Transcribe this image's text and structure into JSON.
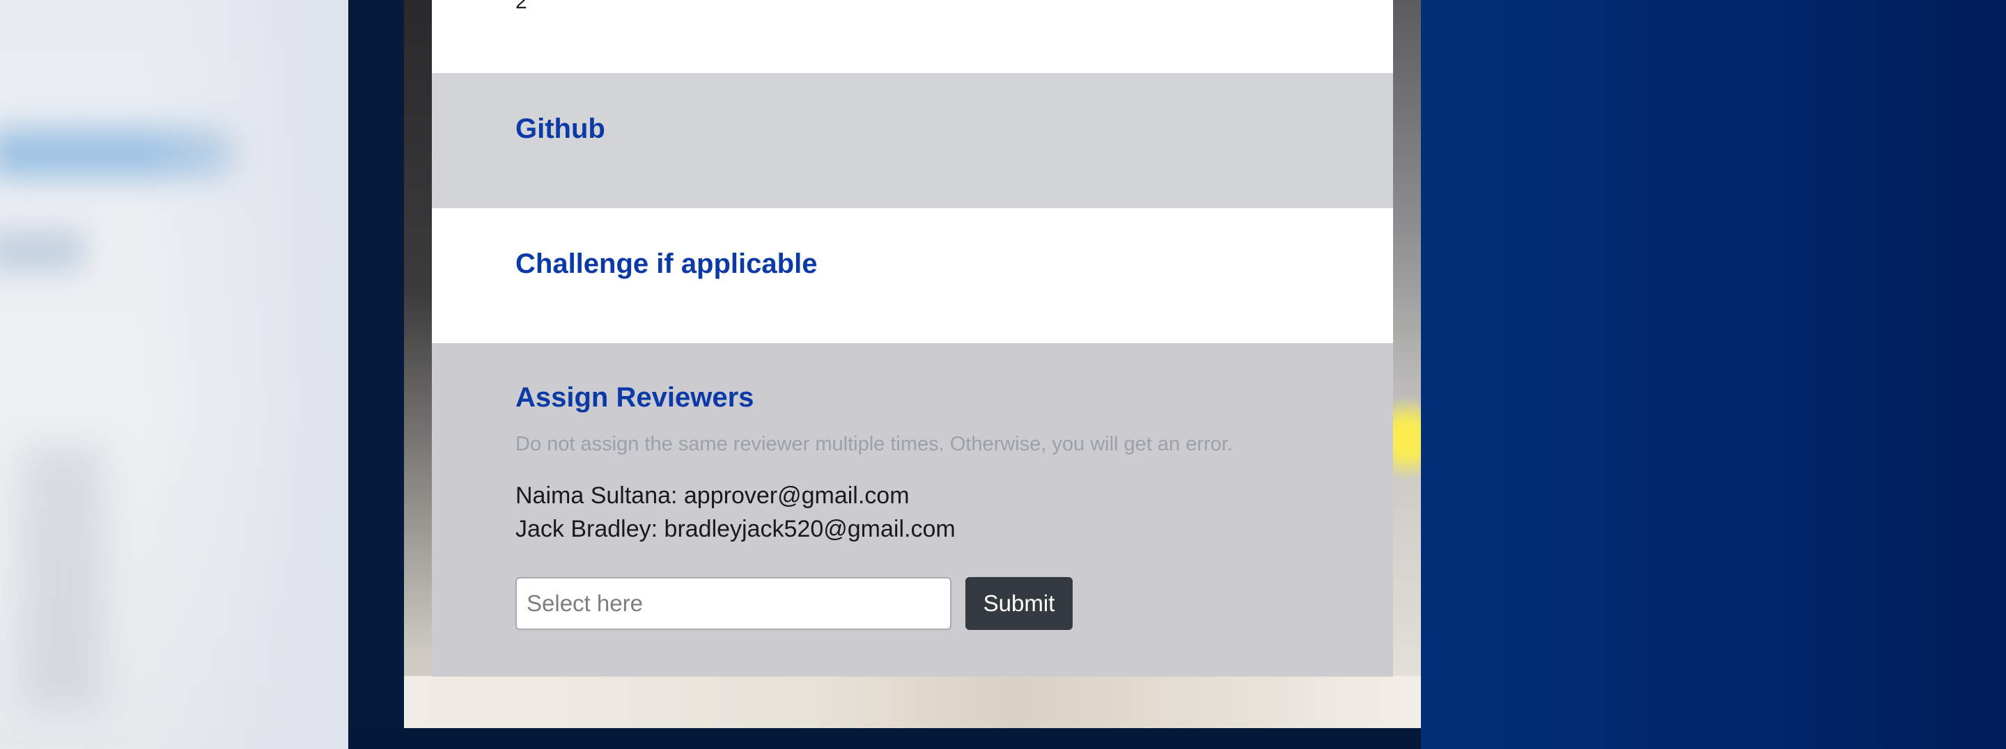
{
  "top_section": {
    "fragment_text": "2"
  },
  "github_section": {
    "title": "Github"
  },
  "challenge_section": {
    "title": "Challenge if applicable"
  },
  "assign_section": {
    "title": "Assign Reviewers",
    "hint": "Do not assign the same reviewer multiple times. Otherwise, you will get an error.",
    "reviewers": [
      "Naima Sultana: approver@gmail.com",
      "Jack Bradley: bradleyjack520@gmail.com"
    ],
    "input": {
      "value": "",
      "placeholder": "Select here"
    },
    "submit_label": "Submit"
  },
  "colors": {
    "heading": "#0b3aa7",
    "section_gray": "#d3d4d8",
    "section_gray_dark": "#ccccd0",
    "button_dark": "#343a40",
    "page_navy": "#051a3d",
    "page_blue": "#002f78"
  }
}
